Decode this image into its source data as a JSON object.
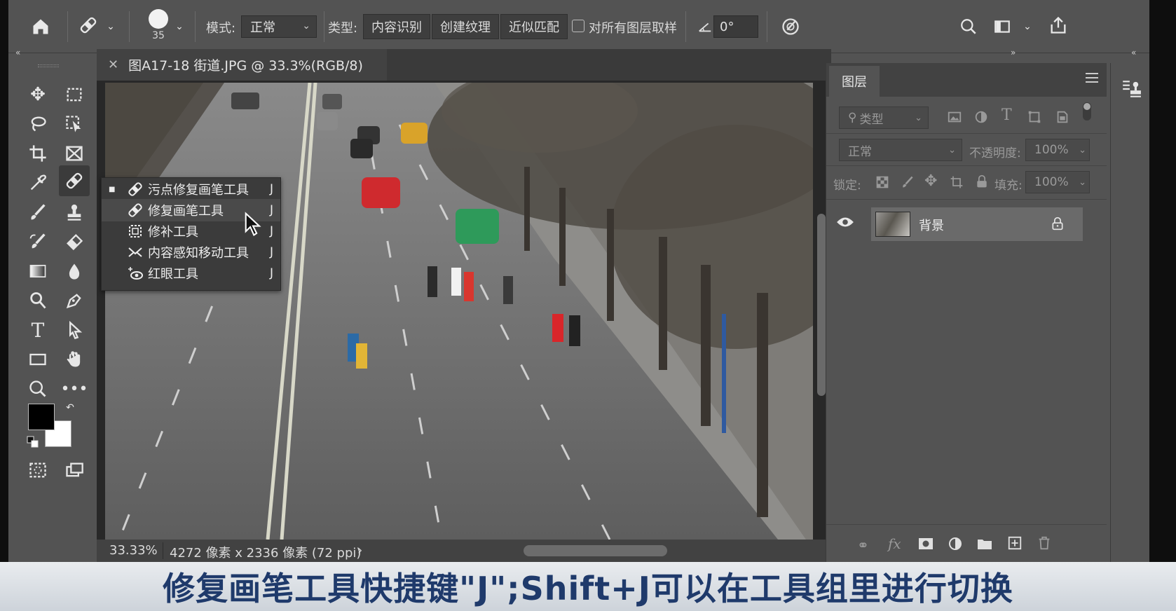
{
  "options_bar": {
    "brush_size": "35",
    "mode_label": "模式:",
    "mode_value": "正常",
    "type_label": "类型:",
    "type_buttons": [
      "内容识别",
      "创建纹理",
      "近似匹配"
    ],
    "sample_all_layers": "对所有图层取样",
    "angle_value": "0°"
  },
  "document": {
    "tab_title": "图A17-18 街道.JPG @ 33.3%(RGB/8)",
    "zoom": "33.33%",
    "dimensions": "4272 像素 x 2336 像素 (72 ppi)",
    "status_arrow": "›"
  },
  "flyout": {
    "items": [
      {
        "label": "污点修复画笔工具",
        "key": "J",
        "bullet": "■",
        "icon": "spot-healing-brush-icon"
      },
      {
        "label": "修复画笔工具",
        "key": "J",
        "bullet": "",
        "icon": "healing-brush-icon"
      },
      {
        "label": "修补工具",
        "key": "J",
        "bullet": "",
        "icon": "patch-tool-icon"
      },
      {
        "label": "内容感知移动工具",
        "key": "J",
        "bullet": "",
        "icon": "content-aware-move-icon"
      },
      {
        "label": "红眼工具",
        "key": "J",
        "bullet": "",
        "icon": "red-eye-icon"
      }
    ]
  },
  "layers_panel": {
    "tab": "图层",
    "filter_kind": "类型",
    "blend_mode": "正常",
    "opacity_label": "不透明度:",
    "opacity_value": "100%",
    "lock_label": "锁定:",
    "fill_label": "填充:",
    "fill_value": "100%",
    "layers": [
      {
        "name": "背景",
        "visible": true,
        "locked": true
      }
    ]
  },
  "subtitle": "修复画笔工具快捷键\"J\";Shift+J可以在工具组里进行切换",
  "colors": {
    "ui_bg": "#535353",
    "panel_dark": "#424242",
    "canvas_bg": "#282828",
    "subtitle_text": "#1f3a6b"
  }
}
